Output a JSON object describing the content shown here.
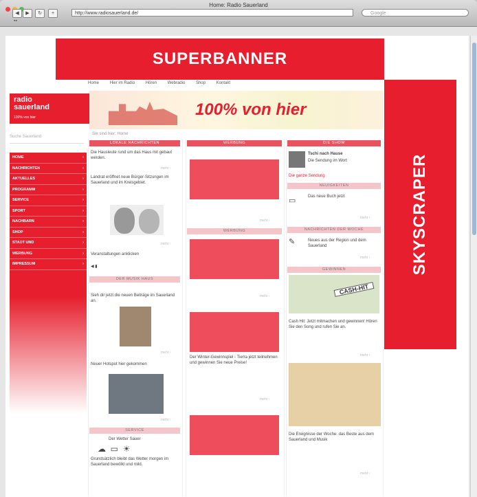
{
  "window": {
    "title": "Home: Radio Sauerland",
    "url": "http://www.radiosauerland.de/",
    "search_placeholder": "Google",
    "bookmarks": "▪▪"
  },
  "ads": {
    "superbanner": "SUPERBANNER",
    "skyscraper": "SKYSCRAPER"
  },
  "site": {
    "topnav": [
      "Home",
      "Hier im Radio",
      "Hören",
      "Webradio",
      "Shop",
      "Kontakt"
    ],
    "logo_line1": "radio",
    "logo_line2": "sauerland",
    "logo_tag": "100% von hier",
    "slogan": "100% von hier",
    "search_label": "Suche Sauerland",
    "breadcrumb": "Sie sind hier: Home"
  },
  "sidebar": {
    "items": [
      "HOME",
      "NACHRICHTEN",
      "AKTUELLES",
      "PROGRAMM",
      "SERVICE",
      "SPORT",
      "NACHBARN",
      "SHOP",
      "STADT UND",
      "WERBUNG",
      "IMPRESSUM"
    ]
  },
  "columns": {
    "col1_head": "LOKALE NACHRICHTEN",
    "col1_text1": "Die Hausleute rund um das Haus mit gebaut werden.",
    "col1_text2": "Landrat eröffnet neue Bürger-Sitzungen im Sauerland und im Kreisgebiet.",
    "col1_text3": "Veranstaltungen anklicken",
    "col1_head2": "DER MUSIK HAUS",
    "col1_text4": "Sieh dir jetzt die neuen Beiträge im Sauerland an.",
    "col1_text5": "Neuer Hotspot hier gekommen",
    "col1_head3": "SERVICE",
    "col1_text6": "Der Wetter Sauer",
    "col1_text7": "Grundsätzlich bleibt das Wetter morgen im Sauerland bewölkt und mild.",
    "col2_head1": "WERBUNG",
    "col2_head2": "WERBUNG",
    "col2_text": "Der Winter-Gewinnspiel - Tierra jetzt teilnehmen und gewinnen Sie neue Preise!",
    "col3_head1": "DIE SHOW",
    "col3_sub1": "Tschi nach Hause",
    "col3_sub1b": "Die Sendung im Wort",
    "col3_link1": "Die ganze Sendung",
    "col3_head2": "NEUIGKEITEN",
    "col3_text2": "Das neue Buch jetzt",
    "col3_head3": "NACHRICHTEN DER WOCHE",
    "col3_text3": "Neues aus der Region und dem Sauerland",
    "col3_head4": "GEWINNEN",
    "col3_badge": "CASH-HIT",
    "col3_text4": "Cash Hit: Jetzt mitmachen und gewinnen! Hören Sie den Song und rufen Sie an.",
    "col3_text5": "Die Ereignisse der Woche: das Beste aus dem Sauerland und Musik",
    "more": "mehr ›"
  },
  "colors": {
    "brand": "#e61e2d",
    "placeholder": "#ee4d5b"
  }
}
